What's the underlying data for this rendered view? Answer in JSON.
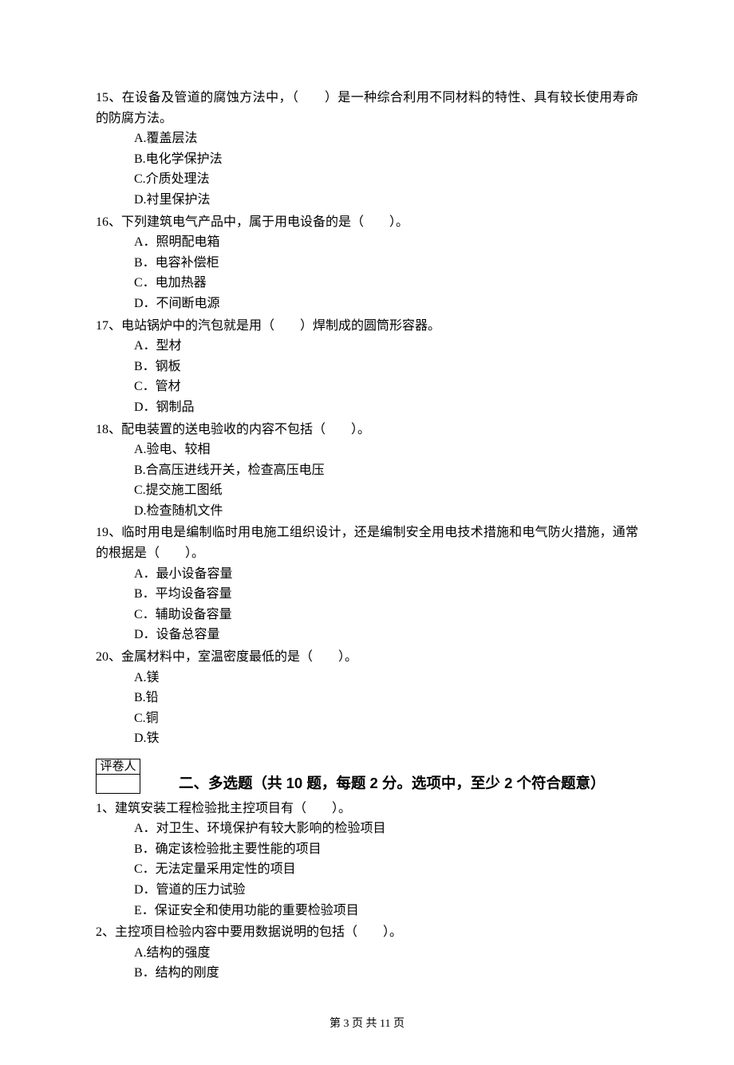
{
  "questions_single": [
    {
      "num": "15、",
      "text": "在设备及管道的腐蚀方法中，（　　）是一种综合利用不同材料的特性、具有较长使用寿命的防腐方法。",
      "options": [
        "A.覆盖层法",
        "B.电化学保护法",
        "C.介质处理法",
        "D.衬里保护法"
      ]
    },
    {
      "num": "16、",
      "text": "下列建筑电气产品中，属于用电设备的是（　　）。",
      "options": [
        "A．照明配电箱",
        "B．电容补偿柜",
        "C．电加热器",
        "D．不间断电源"
      ]
    },
    {
      "num": "17、",
      "text": "电站锅炉中的汽包就是用（　　）焊制成的圆筒形容器。",
      "options": [
        "A．型材",
        "B．钢板",
        "C．管材",
        "D．钢制品"
      ]
    },
    {
      "num": "18、",
      "text": "配电装置的送电验收的内容不包括（　　）。",
      "options": [
        "A.验电、较相",
        "B.合高压进线开关，检查高压电压",
        "C.提交施工图纸",
        "D.检查随机文件"
      ]
    },
    {
      "num": "19、",
      "text": "临时用电是编制临时用电施工组织设计，还是编制安全用电技术措施和电气防火措施，通常的根据是（　　）。",
      "options": [
        "A．最小设备容量",
        "B．平均设备容量",
        "C．辅助设备容量",
        "D．设备总容量"
      ]
    },
    {
      "num": "20、",
      "text": "金属材料中，室温密度最低的是（　　）。",
      "options": [
        "A.镁",
        "B.铅",
        "C.铜",
        "D.铁"
      ]
    }
  ],
  "grader_label": "评卷人",
  "section2_heading": "二、多选题（共 10 题，每题 2 分。选项中，至少 2 个符合题意）",
  "questions_multi": [
    {
      "num": "1、",
      "text": "建筑安装工程检验批主控项目有（　　）。",
      "options": [
        "A．对卫生、环境保护有较大影响的检验项目",
        "B．确定该检验批主要性能的项目",
        "C．无法定量采用定性的项目",
        "D．管道的压力试验",
        "E．保证安全和使用功能的重要检验项目"
      ]
    },
    {
      "num": "2、",
      "text": "主控项目检验内容中要用数据说明的包括（　　）。",
      "options": [
        "A.结构的强度",
        "B．结构的刚度"
      ]
    }
  ],
  "footer": "第 3 页 共 11 页"
}
